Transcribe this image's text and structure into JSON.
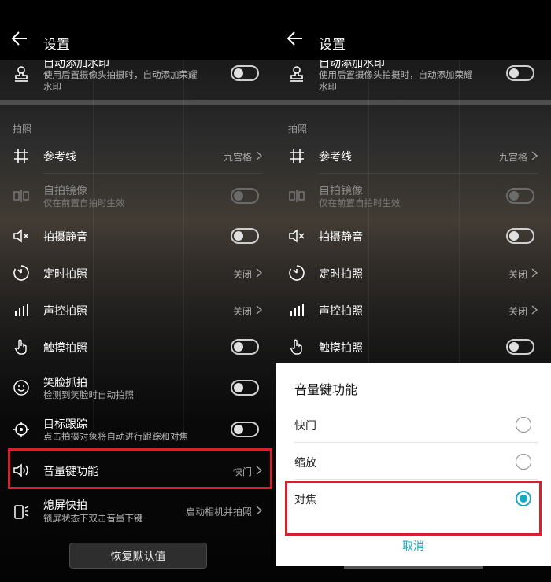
{
  "left": {
    "title": "设置",
    "watermark": {
      "label": "自动添加水印",
      "sub1": "使用后置摄像头拍摄时，自动添加荣耀",
      "sub2": "水印"
    },
    "section": "拍照",
    "gridlines": {
      "label": "参考线",
      "value": "九宫格"
    },
    "mirror": {
      "label": "自拍镜像",
      "sub": "仅在前置自拍时生效"
    },
    "mute": {
      "label": "拍摄静音"
    },
    "timer": {
      "label": "定时拍照",
      "value": "关闭"
    },
    "audio": {
      "label": "声控拍照",
      "value": "关闭"
    },
    "touch": {
      "label": "触摸拍照"
    },
    "smile": {
      "label": "笑脸抓拍",
      "sub": "检测到笑脸时自动拍照"
    },
    "tracking": {
      "label": "目标跟踪",
      "sub": "点击拍摄对象将自动进行跟踪和对焦"
    },
    "volume": {
      "label": "音量键功能",
      "value": "快门"
    },
    "ultra": {
      "label": "熄屏快拍",
      "sub": "锁屏状态下双击音量下键",
      "value": "启动相机并拍照"
    },
    "restore": "恢复默认值"
  },
  "right": {
    "title": "设置",
    "watermark": {
      "label": "自动添加水印",
      "sub1": "使用后置摄像头拍摄时，自动添加荣耀",
      "sub2": "水印"
    },
    "section": "拍照",
    "gridlines": {
      "label": "参考线",
      "value": "九宫格"
    },
    "mirror": {
      "label": "自拍镜像",
      "sub": "仅在前置自拍时生效"
    },
    "mute": {
      "label": "拍摄静音"
    },
    "timer": {
      "label": "定时拍照",
      "value": "关闭"
    },
    "audio": {
      "label": "声控拍照",
      "value": "关闭"
    },
    "touch": {
      "label": "触摸拍照"
    }
  },
  "dialog": {
    "title": "音量键功能",
    "options": [
      {
        "label": "快门",
        "selected": false
      },
      {
        "label": "缩放",
        "selected": false
      },
      {
        "label": "对焦",
        "selected": true
      }
    ],
    "cancel": "取消"
  },
  "colors": {
    "accent": "#1aa7c3",
    "highlight": "#d7202b"
  }
}
